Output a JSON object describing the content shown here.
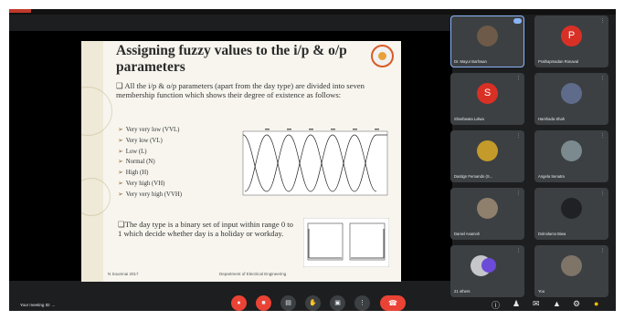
{
  "slide": {
    "title": "Assigning fuzzy values to the i/p & o/p parameters",
    "bullet1": "❑ All the i/p & o/p parameters (apart from the day type) are divided into seven membership function which shows their degree of existence as follows:",
    "memberships": [
      "Very very low (VVL)",
      "Very low (VL)",
      "Low (L)",
      "Normal (N)",
      "High (H)",
      "Very high (VH)",
      "Very very high (VVH)"
    ],
    "bullet2": "❑The day type is a binary set of input within range 0 to 1 which decide whether day is a holiday or workday.",
    "footer_left": "N Soumnai 2017",
    "footer_right": "Department of Electrical Engineering"
  },
  "participants": [
    {
      "name": "Dr. Mayur Barhwan",
      "avatar_color": "#6d5a48",
      "initial": "",
      "speaking": true
    },
    {
      "name": "Prathapmadan Ronaval",
      "avatar_color": "#d93025",
      "initial": "P",
      "speaking": false
    },
    {
      "name": "Shashwata Lalwa",
      "avatar_color": "#d93025",
      "initial": "S",
      "speaking": false
    },
    {
      "name": "Harshada Shah",
      "avatar_color": "#5f6b8a",
      "initial": "",
      "speaking": false
    },
    {
      "name": "Dastign Fernando (S...",
      "avatar_color": "#c49a2a",
      "initial": "",
      "speaking": false
    },
    {
      "name": "Angela Senatra",
      "avatar_color": "#7a8a8f",
      "initial": "",
      "speaking": false
    },
    {
      "name": "Daniel Asamoh",
      "avatar_color": "#8f7f6d",
      "initial": "",
      "speaking": false
    },
    {
      "name": "Dolnolamo Biwa",
      "avatar_color": "#202124",
      "initial": "",
      "speaking": false
    },
    {
      "name": "21 others",
      "avatar_color": "#c5c7ca",
      "initial": "",
      "speaking": false
    },
    {
      "name": "You",
      "avatar_color": "#7f7468",
      "initial": "",
      "speaking": false
    }
  ],
  "bottom_bar": {
    "self_name": "Your meeting ID: ..."
  },
  "colors": {
    "meeting_bg": "#1d1e20",
    "tile_bg": "#3c4043",
    "control_red": "#ea4335",
    "accent_blue": "#8ab4f8"
  }
}
